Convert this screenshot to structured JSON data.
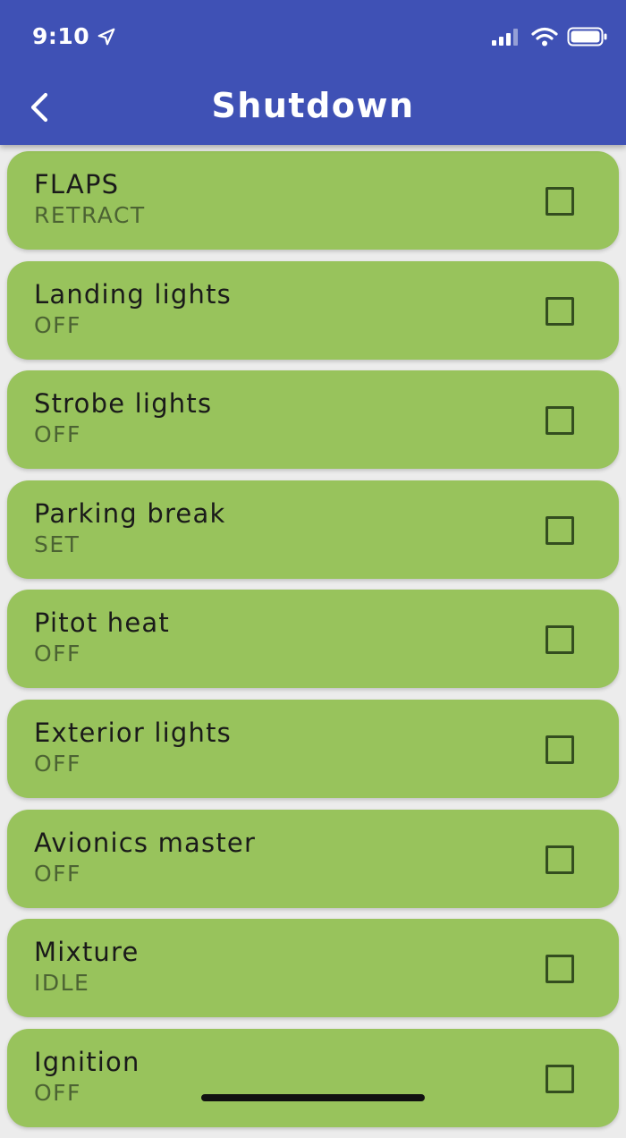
{
  "status_bar": {
    "time": "9:10"
  },
  "header": {
    "title": "Shutdown"
  },
  "colors": {
    "appbar": "#3f51b5",
    "card": "#98c35c",
    "background": "#ececec"
  },
  "items": [
    {
      "title": "FLAPS",
      "value": "RETRACT"
    },
    {
      "title": "Landing lights",
      "value": "OFF"
    },
    {
      "title": "Strobe lights",
      "value": "OFF"
    },
    {
      "title": "Parking break",
      "value": "SET"
    },
    {
      "title": "Pitot heat",
      "value": "OFF"
    },
    {
      "title": "Exterior lights",
      "value": "OFF"
    },
    {
      "title": "Avionics master",
      "value": "OFF"
    },
    {
      "title": "Mixture",
      "value": "IDLE"
    },
    {
      "title": "Ignition",
      "value": "OFF"
    }
  ]
}
